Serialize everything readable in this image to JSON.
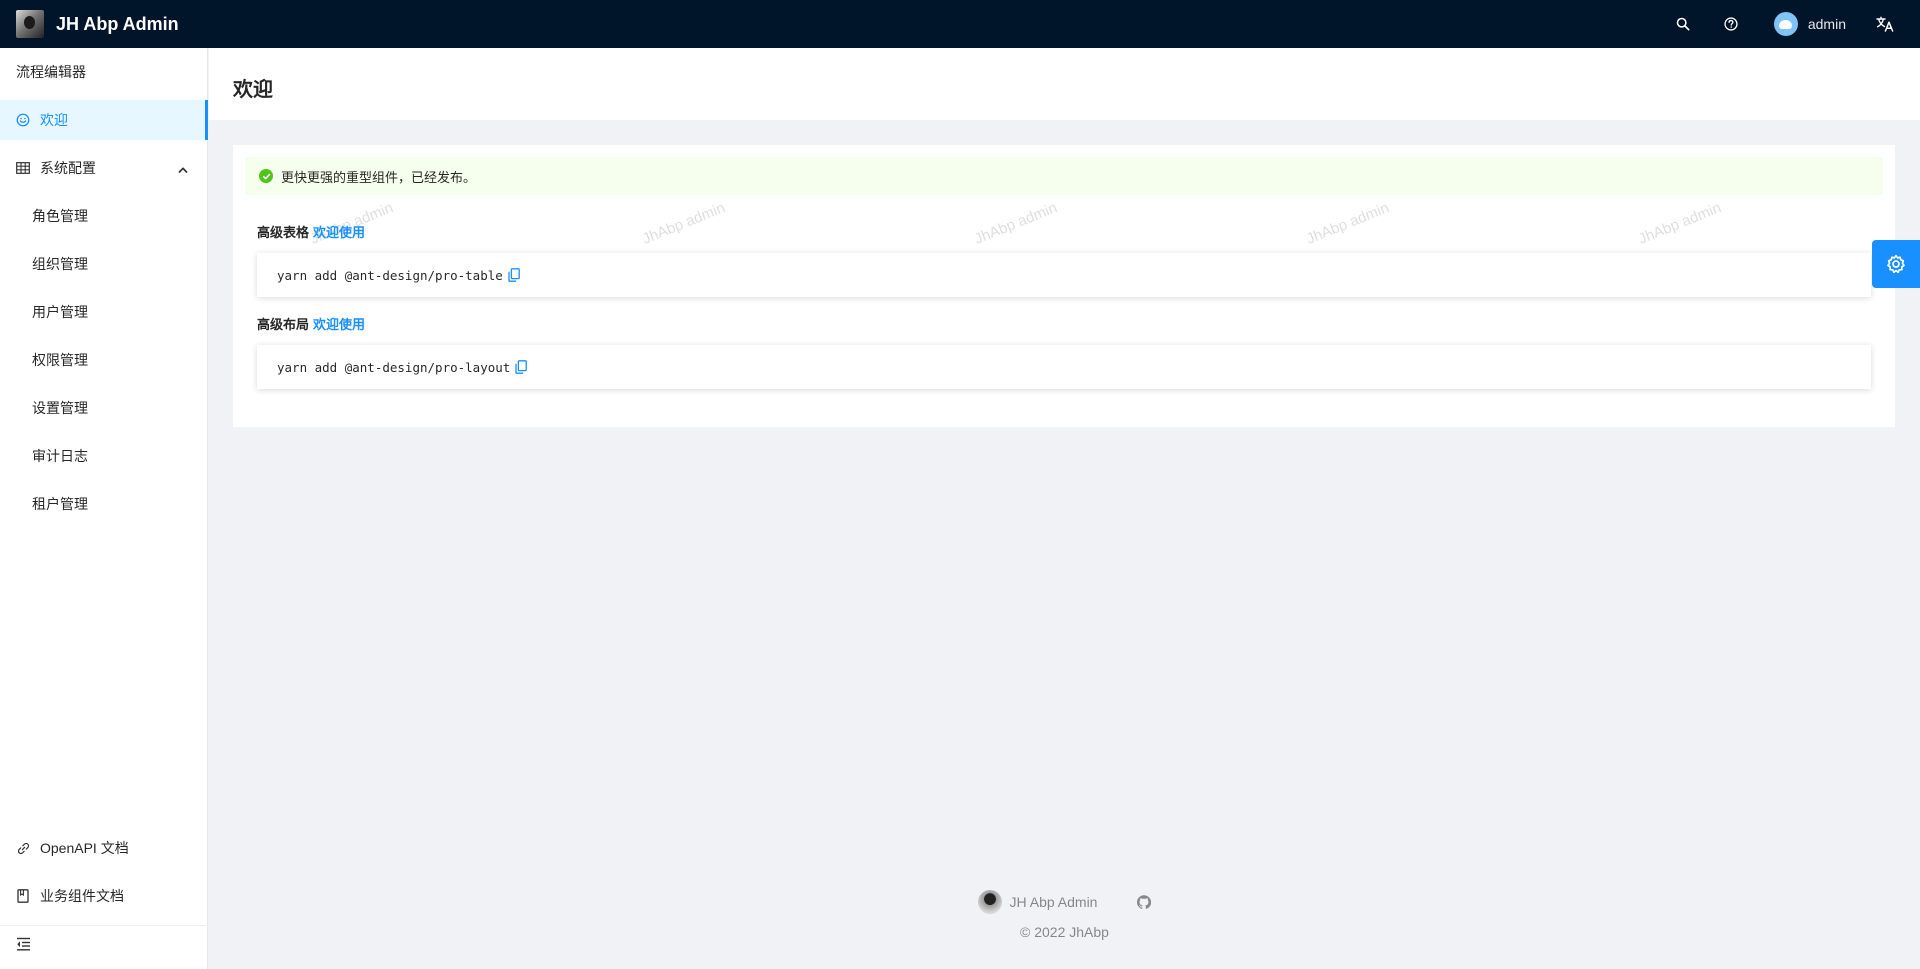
{
  "app": {
    "title": "JH Abp Admin"
  },
  "header": {
    "user_name": "admin",
    "icons": [
      "search-icon",
      "question-circle-icon",
      "translate-icon"
    ]
  },
  "sidebar": {
    "items": [
      {
        "label": "流程编辑器",
        "icon": ""
      },
      {
        "label": "欢迎",
        "icon": "smile-icon",
        "active": true
      },
      {
        "label": "系统配置",
        "icon": "table-icon",
        "expanded": true
      },
      {
        "label": "角色管理"
      },
      {
        "label": "组织管理"
      },
      {
        "label": "用户管理"
      },
      {
        "label": "权限管理"
      },
      {
        "label": "设置管理"
      },
      {
        "label": "审计日志"
      },
      {
        "label": "租户管理"
      }
    ],
    "links": [
      {
        "label": "OpenAPI 文档",
        "icon": "link-icon"
      },
      {
        "label": "业务组件文档",
        "icon": "book-icon"
      }
    ]
  },
  "page": {
    "title": "欢迎"
  },
  "alert": {
    "message": "更快更强的重型组件，已经发布。",
    "type": "success",
    "color": "#52c41a"
  },
  "sections": [
    {
      "label": "高级表格",
      "link": "欢迎使用",
      "code": "yarn add @ant-design/pro-table"
    },
    {
      "label": "高级布局",
      "link": "欢迎使用",
      "code": "yarn add @ant-design/pro-layout"
    }
  ],
  "watermark": "JhAbp admin",
  "footer": {
    "name": "JH Abp Admin",
    "copyright": "2022 JhAbp"
  },
  "colors": {
    "primary": "#1890ff",
    "header_bg": "#001529",
    "page_bg": "#f0f2f5"
  }
}
